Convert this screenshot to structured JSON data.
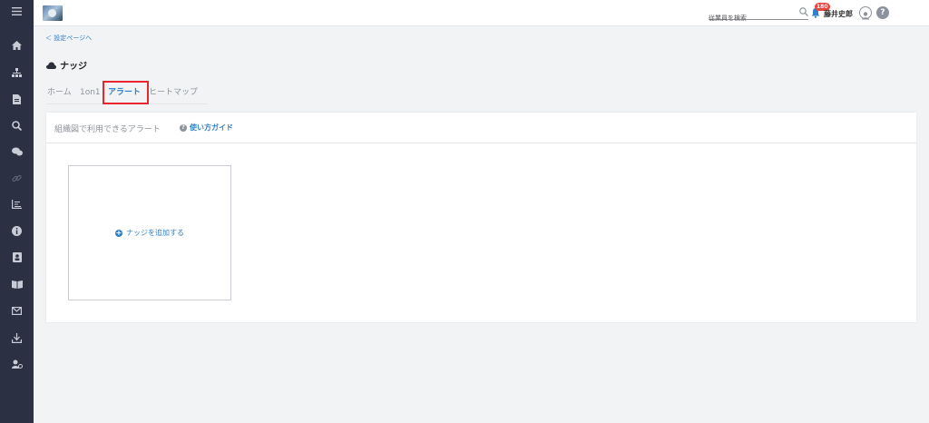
{
  "header": {
    "search_placeholder": "従業員を検索",
    "notification_count": "180",
    "user_name": "藤井史郎",
    "help_label": "?"
  },
  "sidebar": {
    "items": [
      {
        "icon": "menu-icon"
      },
      {
        "icon": "home-icon"
      },
      {
        "icon": "org-chart-icon"
      },
      {
        "icon": "document-icon"
      },
      {
        "icon": "search-icon"
      },
      {
        "icon": "chat-icon"
      },
      {
        "icon": "link-icon"
      },
      {
        "icon": "chart-icon"
      },
      {
        "icon": "info-icon"
      },
      {
        "icon": "contact-book-icon"
      },
      {
        "icon": "book-icon"
      },
      {
        "icon": "mail-icon"
      },
      {
        "icon": "download-icon"
      },
      {
        "icon": "user-settings-icon"
      }
    ]
  },
  "main": {
    "back_link": "＜ 設定ページへ",
    "title": "ナッジ",
    "tabs": [
      {
        "label": "ホーム"
      },
      {
        "label": "1on1"
      },
      {
        "label": "アラート",
        "active": true
      },
      {
        "label": "ヒートマップ"
      }
    ],
    "card": {
      "header_label": "組織図で利用できるアラート",
      "guide_label": "使い方ガイド",
      "add_label": "ナッジを追加する"
    }
  },
  "colors": {
    "sidebar_bg": "#2b3142",
    "accent": "#2f80c9",
    "highlight": "#e8262e",
    "badge": "#e8453c"
  }
}
